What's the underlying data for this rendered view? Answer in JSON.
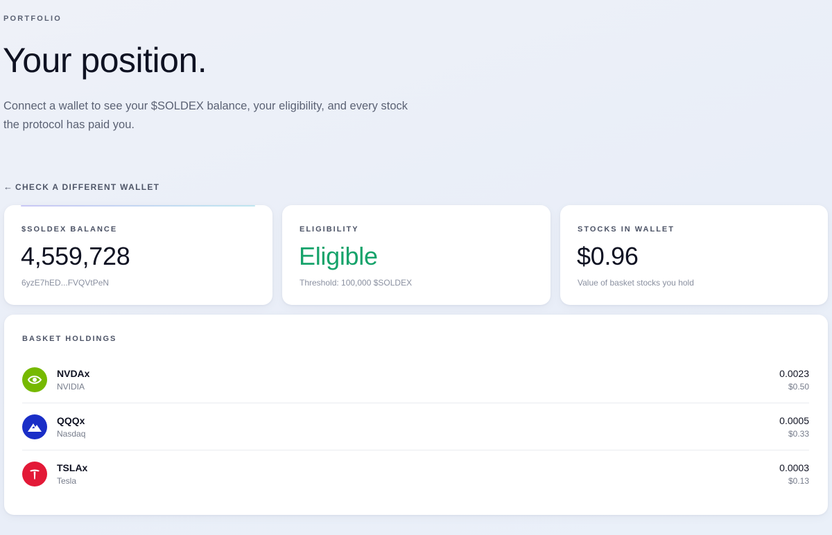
{
  "header": {
    "eyebrow": "PORTFOLIO",
    "title": "Your position.",
    "subtitle": "Connect a wallet to see your $SOLDEX balance, your eligibility, and every stock the protocol has paid you."
  },
  "back_link": {
    "arrow": "←",
    "label": "CHECK A DIFFERENT WALLET"
  },
  "stats": {
    "balance": {
      "label": "$SOLDEX BALANCE",
      "value": "4,559,728",
      "note": "6yzE7hED...FVQVtPeN"
    },
    "eligibility": {
      "label": "ELIGIBILITY",
      "value": "Eligible",
      "note": "Threshold: 100,000 $SOLDEX"
    },
    "stocks": {
      "label": "STOCKS IN WALLET",
      "value": "$0.96",
      "note": "Value of basket stocks you hold"
    }
  },
  "holdings": {
    "label": "BASKET HOLDINGS",
    "items": [
      {
        "ticker": "NVDAx",
        "name": "NVIDIA",
        "qty": "0.0023",
        "usd": "$0.50",
        "icon": "nvidia-logo-icon",
        "color": "#76b900"
      },
      {
        "ticker": "QQQx",
        "name": "Nasdaq",
        "qty": "0.0005",
        "usd": "$0.33",
        "icon": "nasdaq-logo-icon",
        "color": "#1a2ec7"
      },
      {
        "ticker": "TSLAx",
        "name": "Tesla",
        "qty": "0.0003",
        "usd": "$0.13",
        "icon": "tesla-logo-icon",
        "color": "#e31937"
      }
    ]
  },
  "colors": {
    "eligible_green": "#16a36b",
    "text_primary": "#0f1222",
    "text_muted": "#757b8a"
  }
}
